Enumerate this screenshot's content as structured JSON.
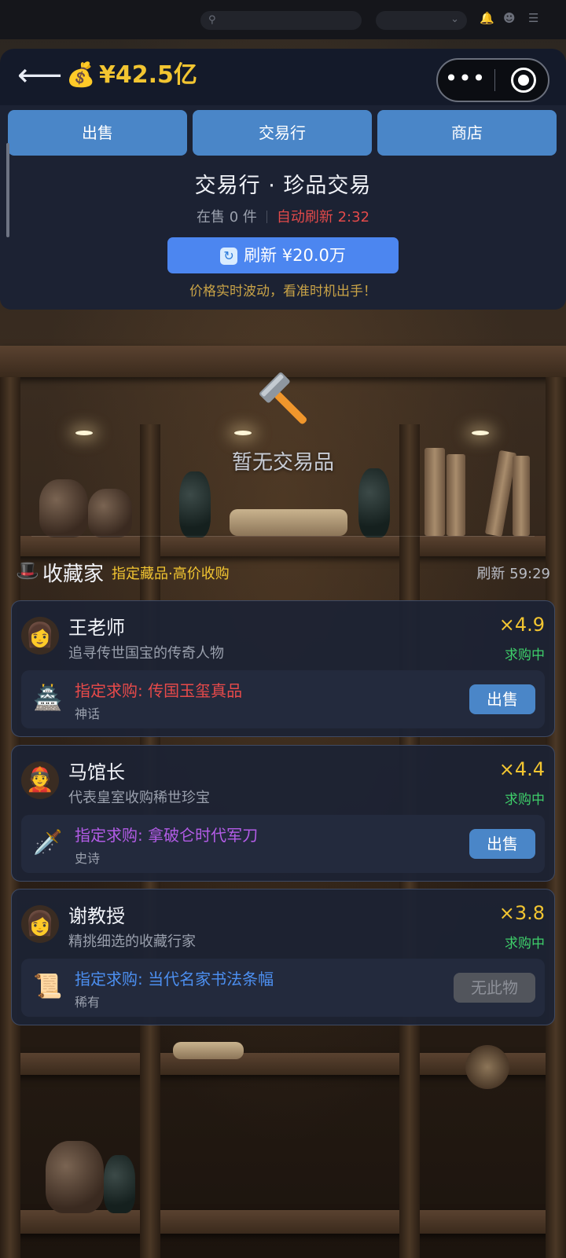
{
  "system_bar": {
    "search_icon": "search-icon",
    "dropdown_icon": "chevron-down-icon",
    "icons": [
      "bell-icon",
      "user-icon",
      "menu-icon"
    ]
  },
  "header": {
    "back_icon": "arrow-left-icon",
    "money_icon": "money-bag-icon",
    "money": "¥42.5亿",
    "capsule_more": "•••",
    "capsule_record_icon": "record-icon"
  },
  "tabs": [
    "出售",
    "交易行",
    "商店"
  ],
  "market": {
    "title": "交易行 · 珍品交易",
    "on_sale": "在售 0 件",
    "auto_refresh": "自动刷新 2:32",
    "refresh_label": "刷新 ¥20.0万",
    "refresh_icon": "refresh-icon",
    "hint": "价格实时波动，看准时机出手！",
    "empty_icon": "hammer-icon",
    "empty_text": "暂无交易品"
  },
  "collectors": {
    "icon": "top-hat-icon",
    "title": "收藏家",
    "subtitle": "指定藏品·高价收购",
    "timer": "刷新 59:29",
    "buyers": [
      {
        "avatar": "👩",
        "name": "王老师",
        "desc": "追寻传世国宝的传奇人物",
        "multiplier": "×4.9",
        "status": "求购中",
        "item_icon": "jade-seal-icon",
        "request": "指定求购: 传国玉玺真品",
        "request_color": "#e84a4a",
        "rarity": "神话",
        "action": "出售"
      },
      {
        "avatar": "👲",
        "name": "马馆长",
        "desc": "代表皇室收购稀世珍宝",
        "multiplier": "×4.4",
        "status": "求购中",
        "item_icon": "saber-icon",
        "request": "指定求购: 拿破仑时代军刀",
        "request_color": "#b25ce6",
        "rarity": "史诗",
        "action": "出售"
      },
      {
        "avatar": "👩",
        "name": "谢教授",
        "desc": "精挑细选的收藏行家",
        "multiplier": "×3.8",
        "status": "求购中",
        "item_icon": "calligraphy-scroll-icon",
        "request": "指定求购: 当代名家书法条幅",
        "request_color": "#4c8ff0",
        "rarity": "稀有",
        "action": "无此物"
      }
    ]
  },
  "colors": {
    "gold": "#f2c531",
    "accent_blue": "#4a86c8",
    "refresh_blue": "#4c86f0",
    "alert_red": "#e24a4a",
    "status_green": "#3ecf6a"
  }
}
